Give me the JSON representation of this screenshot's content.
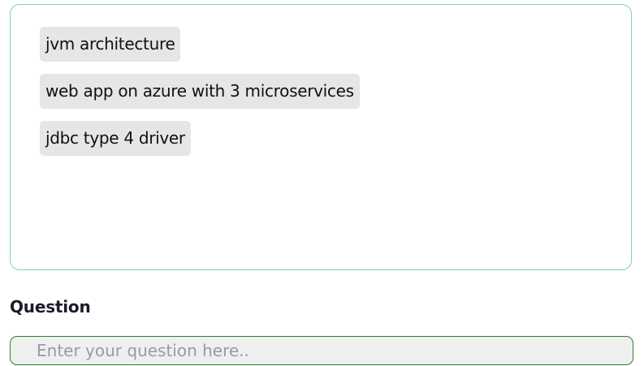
{
  "suggestions": {
    "items": [
      {
        "label": "jvm architecture"
      },
      {
        "label": "web app on azure with 3 microservices"
      },
      {
        "label": "jdbc type 4 driver"
      }
    ]
  },
  "question": {
    "label": "Question",
    "value": "",
    "placeholder": "Enter your question here.."
  },
  "colors": {
    "suggestions_border": "#7fd3b0",
    "chip_background": "#e6e6e6",
    "input_border": "#2e7d32",
    "input_background": "#efefef"
  }
}
